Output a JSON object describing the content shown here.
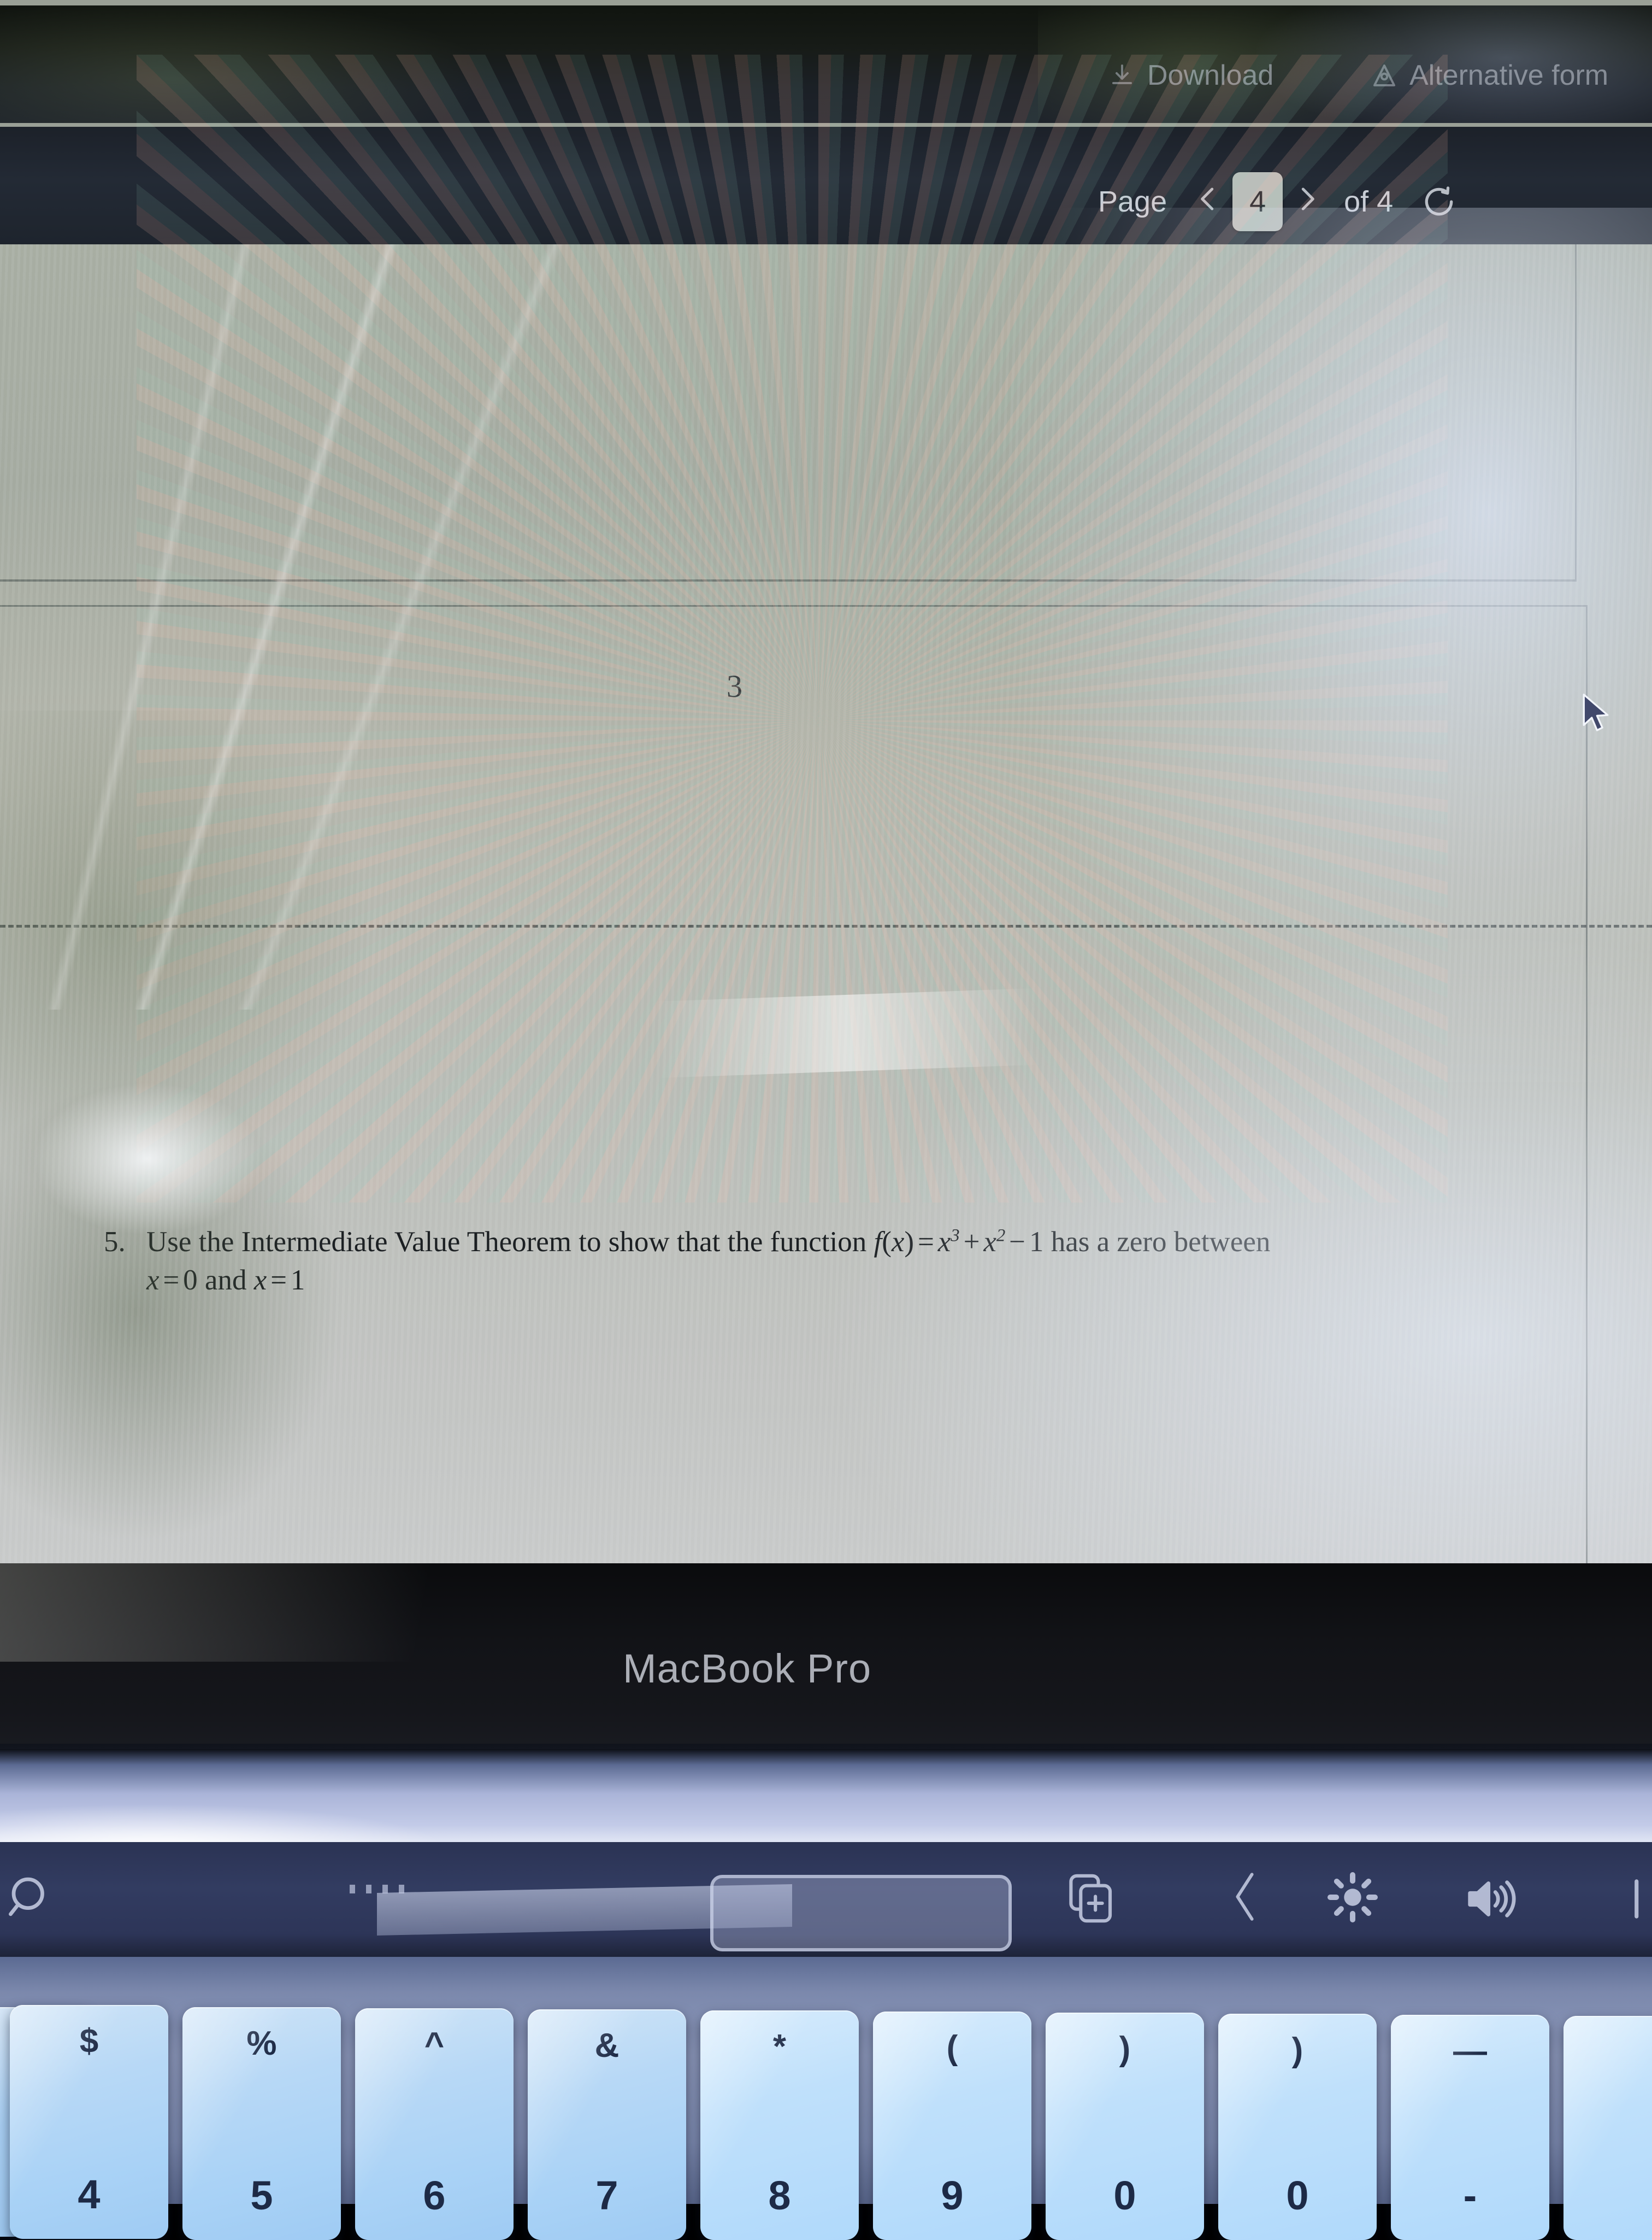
{
  "device": {
    "brand_label": "MacBook Pro"
  },
  "viewer": {
    "toolbar": {
      "download_label": "Download",
      "download_icon": "download-icon",
      "alternative_formats_label": "Alternative form",
      "alternative_formats_icon": "ally-icon"
    },
    "pagination": {
      "page_label": "Page",
      "prev_icon": "chevron-left-icon",
      "next_icon": "chevron-right-icon",
      "current_page": "4",
      "of_label": "of 4",
      "reload_icon": "rotate-icon"
    }
  },
  "document": {
    "previous_page_number": "3",
    "problem": {
      "number": "5.",
      "line1_a": "Use the Intermediate Value Theorem to show that the function ",
      "fn_f": "f",
      "fn_open": "(",
      "fn_var": "x",
      "fn_close": ")",
      "fn_eq": "=",
      "term1_base": "x",
      "term1_exp": "3",
      "plus": "+",
      "term2_base": "x",
      "term2_exp": "2",
      "minus": "−",
      "const1": "1",
      "line1_b": " has a zero between",
      "line2_x1": "x",
      "line2_eq1": "=",
      "line2_v1": "0",
      "line2_and": " and ",
      "line2_x2": "x",
      "line2_eq2": "=",
      "line2_v2": "1"
    },
    "cursor_icon": "mouse-pointer-icon"
  },
  "touchbar": {
    "items": [
      {
        "icon": "search-icon"
      },
      {
        "icon": "new-tab-icon"
      },
      {
        "icon": "chevron-left-icon"
      },
      {
        "icon": "brightness-icon"
      },
      {
        "icon": "volume-icon"
      }
    ]
  },
  "keyboard": {
    "keys": [
      {
        "top": "$",
        "bottom": "4"
      },
      {
        "top": "%",
        "bottom": "5"
      },
      {
        "top": "^",
        "bottom": "6"
      },
      {
        "top": "&",
        "bottom": "7"
      },
      {
        "top": "*",
        "bottom": "8"
      },
      {
        "top": "(",
        "bottom": "9"
      },
      {
        "top": ")",
        "bottom": "0"
      },
      {
        "top": "—",
        "bottom": "-"
      }
    ]
  },
  "colors": {
    "toolbar_bg": "#171b21",
    "toolbar_text": "#b9bfc9",
    "page_input_bg": "#c7cbc6",
    "document_bg": "#b4b6ac",
    "document_text": "#1b1f22",
    "touchbar_bg": "#323c61",
    "key_face": "#aed4f5",
    "key_text": "#1d2a46",
    "deck_aluminum": "#c3cbe8"
  }
}
